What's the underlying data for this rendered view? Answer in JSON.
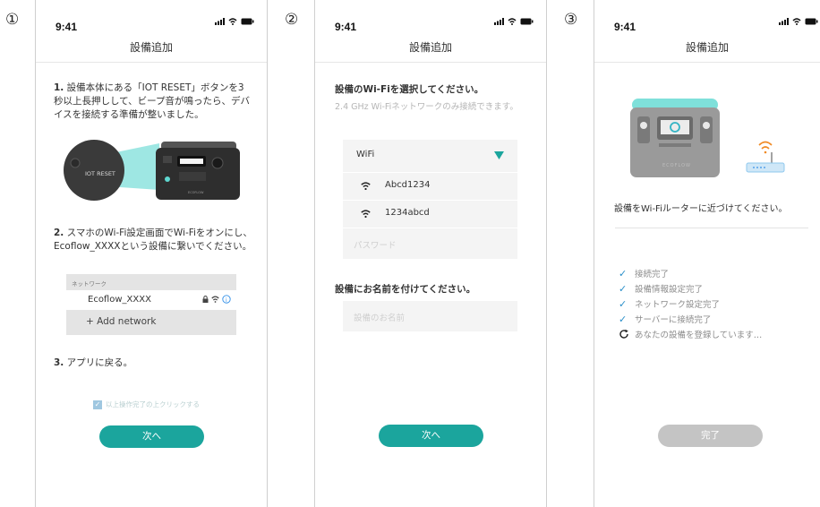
{
  "step_markers": [
    "①",
    "②",
    "③"
  ],
  "status_bar": {
    "time": "9:41"
  },
  "screen1": {
    "title": "設備追加",
    "step1_num": "1.",
    "step1_text": "設備本体にある「IOT RESET」ボタンを3秒以上長押しして、ビープ音が鳴ったら、デバイスを接続する準備が整いました。",
    "button_label": "IOT RESET",
    "step2_num": "2.",
    "step2_text": "スマホのWi-Fi設定画面でWi-Fiをオンにし、Ecoflow_XXXXという設備に繋いでください。",
    "network_header": "ネットワーク",
    "network_name": "Ecoflow_XXXX",
    "add_network": "+ Add network",
    "step3_num": "3.",
    "step3_text": "アプリに戻る。",
    "checkbox_label": "以上操作完了の上クリックする",
    "next_button": "次へ"
  },
  "screen2": {
    "title": "設備追加",
    "wifi_heading": "設備のWi-Fiを選択してください。",
    "wifi_note": "2.4 GHz Wi-Fiネットワークのみ接続できます。",
    "wifi_select": "WiFi",
    "networks": [
      "Abcd1234",
      "1234abcd"
    ],
    "password_placeholder": "パスワード",
    "name_heading": "設備にお名前を付けてください。",
    "name_placeholder": "設備のお名前",
    "next_button": "次へ"
  },
  "screen3": {
    "title": "設備追加",
    "brand": "ECOFLOW",
    "instruction": "設備をWi-Fiルーターに近づけてください。",
    "progress": [
      {
        "label": "接続完了",
        "state": "done"
      },
      {
        "label": "設備情報設定完了",
        "state": "done"
      },
      {
        "label": "ネットワーク設定完了",
        "state": "done"
      },
      {
        "label": "サーバーに接続完了",
        "state": "done"
      },
      {
        "label": "あなたの設備を登録しています…",
        "state": "loading"
      }
    ],
    "done_button": "完了"
  },
  "colors": {
    "teal": "#1ba59d",
    "check_blue": "#2a8fc9",
    "disabled": "#c4c4c4"
  }
}
